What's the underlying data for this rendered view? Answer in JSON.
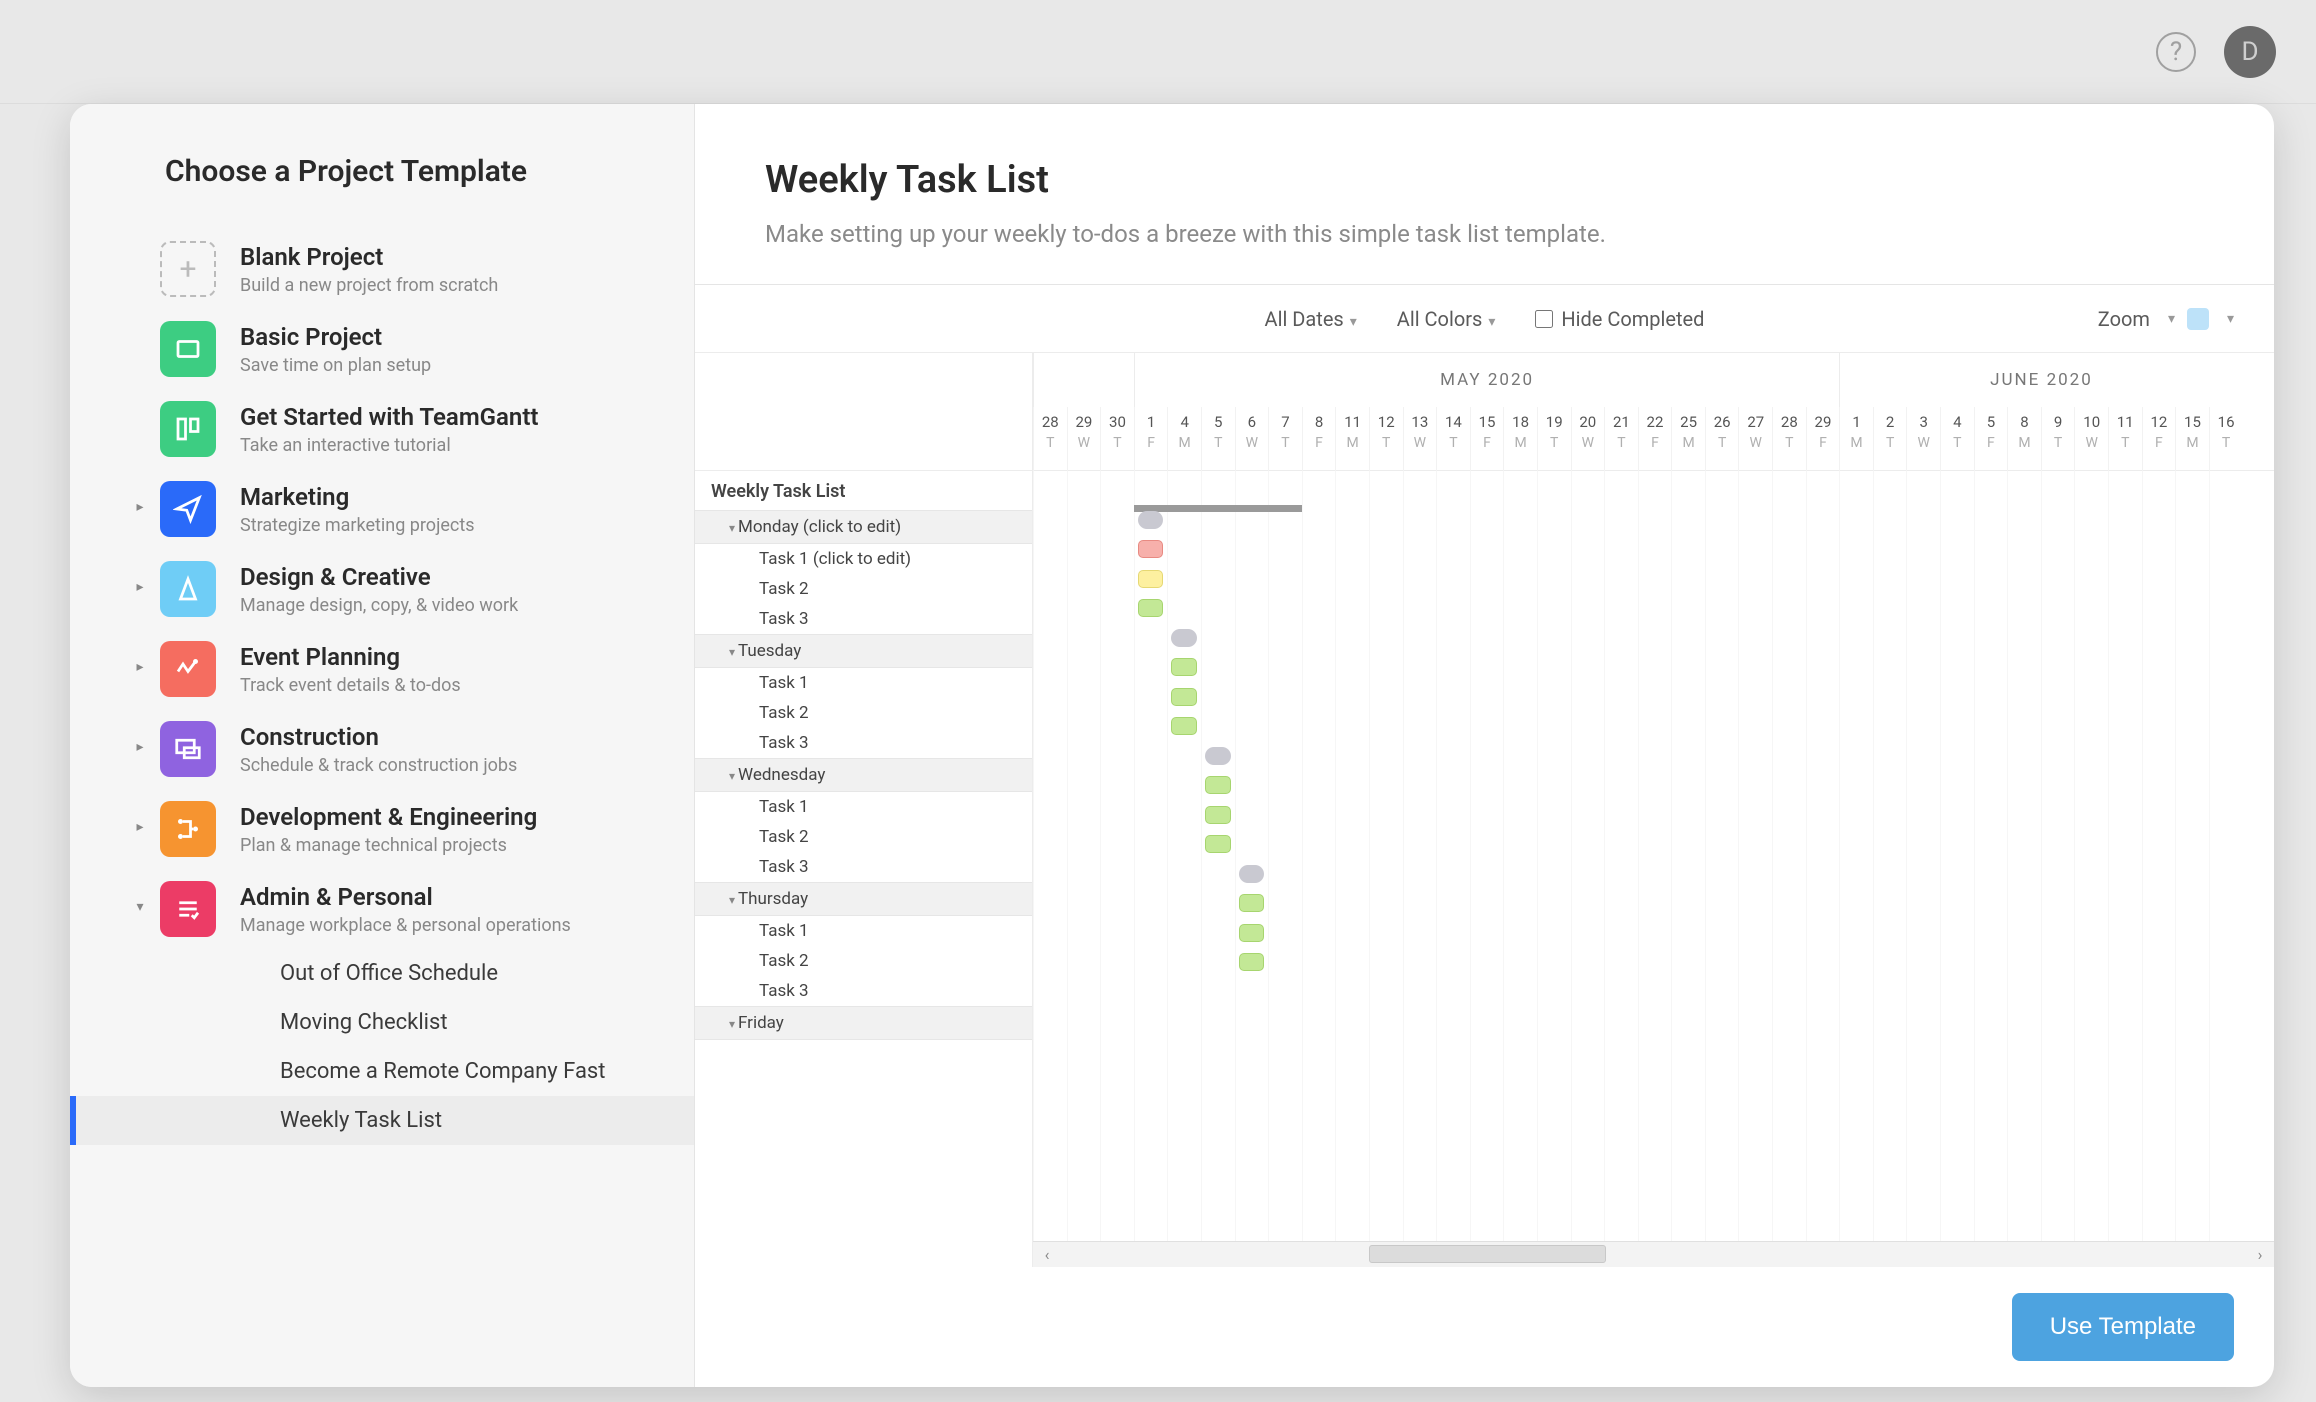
{
  "topbar": {
    "avatar_initial": "D"
  },
  "sidebar": {
    "title": "Choose a Project Template",
    "categories": [
      {
        "name": "Blank Project",
        "desc": "Build a new project from scratch",
        "icon": "blank",
        "expandable": false
      },
      {
        "name": "Basic Project",
        "desc": "Save time on plan setup",
        "icon": "green",
        "expandable": false
      },
      {
        "name": "Get Started with TeamGantt",
        "desc": "Take an interactive tutorial",
        "icon": "green2",
        "expandable": false
      },
      {
        "name": "Marketing",
        "desc": "Strategize marketing projects",
        "icon": "blue",
        "expandable": true
      },
      {
        "name": "Design & Creative",
        "desc": "Manage design, copy, & video work",
        "icon": "sky",
        "expandable": true
      },
      {
        "name": "Event Planning",
        "desc": "Track event details & to-dos",
        "icon": "pink",
        "expandable": true
      },
      {
        "name": "Construction",
        "desc": "Schedule & track construction jobs",
        "icon": "purple",
        "expandable": true
      },
      {
        "name": "Development & Engineering",
        "desc": "Plan & manage technical projects",
        "icon": "orange",
        "expandable": true
      },
      {
        "name": "Admin & Personal",
        "desc": "Manage workplace & personal operations",
        "icon": "red",
        "expandable": true,
        "expanded": true
      }
    ],
    "subitems": [
      "Out of Office Schedule",
      "Moving Checklist",
      "Become a Remote Company Fast",
      "Weekly Task List"
    ],
    "selected_subitem": 3
  },
  "main": {
    "title": "Weekly Task List",
    "desc": "Make setting up your weekly to-dos a breeze with this simple task list template.",
    "use_template": "Use Template"
  },
  "filters": {
    "all_dates": "All Dates",
    "all_colors": "All Colors",
    "hide_completed": "Hide Completed",
    "zoom": "Zoom"
  },
  "timeline": {
    "months": [
      {
        "label": "",
        "cols": 3
      },
      {
        "label": "MAY 2020",
        "cols": 21
      },
      {
        "label": "JUNE 2020",
        "cols": 12
      }
    ],
    "dates": [
      {
        "d": "28",
        "w": "T"
      },
      {
        "d": "29",
        "w": "W"
      },
      {
        "d": "30",
        "w": "T"
      },
      {
        "d": "1",
        "w": "F"
      },
      {
        "d": "4",
        "w": "M"
      },
      {
        "d": "5",
        "w": "T"
      },
      {
        "d": "6",
        "w": "W"
      },
      {
        "d": "7",
        "w": "T"
      },
      {
        "d": "8",
        "w": "F"
      },
      {
        "d": "11",
        "w": "M"
      },
      {
        "d": "12",
        "w": "T"
      },
      {
        "d": "13",
        "w": "W"
      },
      {
        "d": "14",
        "w": "T"
      },
      {
        "d": "15",
        "w": "F"
      },
      {
        "d": "18",
        "w": "M"
      },
      {
        "d": "19",
        "w": "T"
      },
      {
        "d": "20",
        "w": "W"
      },
      {
        "d": "21",
        "w": "T"
      },
      {
        "d": "22",
        "w": "F"
      },
      {
        "d": "25",
        "w": "M"
      },
      {
        "d": "26",
        "w": "T"
      },
      {
        "d": "27",
        "w": "W"
      },
      {
        "d": "28",
        "w": "T"
      },
      {
        "d": "29",
        "w": "F"
      },
      {
        "d": "1",
        "w": "M"
      },
      {
        "d": "2",
        "w": "T"
      },
      {
        "d": "3",
        "w": "W"
      },
      {
        "d": "4",
        "w": "T"
      },
      {
        "d": "5",
        "w": "F"
      },
      {
        "d": "8",
        "w": "M"
      },
      {
        "d": "9",
        "w": "T"
      },
      {
        "d": "10",
        "w": "W"
      },
      {
        "d": "11",
        "w": "T"
      },
      {
        "d": "12",
        "w": "F"
      },
      {
        "d": "15",
        "w": "M"
      },
      {
        "d": "16",
        "w": "T"
      }
    ]
  },
  "gantt": {
    "root": "Weekly Task List",
    "groups": [
      {
        "name": "Monday (click to edit)",
        "tasks": [
          "Task 1 (click to edit)",
          "Task 2",
          "Task 3"
        ]
      },
      {
        "name": "Tuesday",
        "tasks": [
          "Task 1",
          "Task 2",
          "Task 3"
        ]
      },
      {
        "name": "Wednesday",
        "tasks": [
          "Task 1",
          "Task 2",
          "Task 3"
        ]
      },
      {
        "name": "Thursday",
        "tasks": [
          "Task 1",
          "Task 2",
          "Task 3"
        ]
      },
      {
        "name": "Friday",
        "tasks": []
      }
    ],
    "bars": [
      {
        "row": 1,
        "col": 4,
        "span": 1,
        "cls": "grey"
      },
      {
        "row": 2,
        "col": 4,
        "span": 1,
        "cls": "red"
      },
      {
        "row": 3,
        "col": 4,
        "span": 1,
        "cls": "yel"
      },
      {
        "row": 4,
        "col": 4,
        "span": 1,
        "cls": "grn"
      },
      {
        "row": 5,
        "col": 5,
        "span": 1,
        "cls": "grey"
      },
      {
        "row": 6,
        "col": 5,
        "span": 1,
        "cls": "grn"
      },
      {
        "row": 7,
        "col": 5,
        "span": 1,
        "cls": "grn"
      },
      {
        "row": 8,
        "col": 5,
        "span": 1,
        "cls": "grn"
      },
      {
        "row": 9,
        "col": 6,
        "span": 1,
        "cls": "grey"
      },
      {
        "row": 10,
        "col": 6,
        "span": 1,
        "cls": "grn"
      },
      {
        "row": 11,
        "col": 6,
        "span": 1,
        "cls": "grn"
      },
      {
        "row": 12,
        "col": 6,
        "span": 1,
        "cls": "grn"
      },
      {
        "row": 13,
        "col": 7,
        "span": 1,
        "cls": "grey"
      },
      {
        "row": 14,
        "col": 7,
        "span": 1,
        "cls": "grn"
      },
      {
        "row": 15,
        "col": 7,
        "span": 1,
        "cls": "grn"
      },
      {
        "row": 16,
        "col": 7,
        "span": 1,
        "cls": "grn"
      }
    ],
    "progress": {
      "col": 4,
      "span": 5
    }
  }
}
